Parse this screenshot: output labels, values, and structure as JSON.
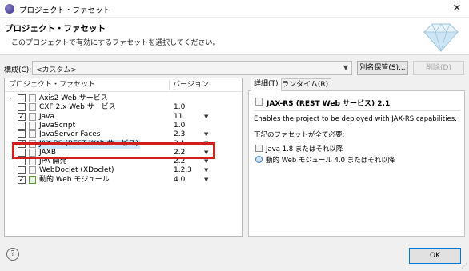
{
  "window": {
    "title": "プロジェクト・ファセット",
    "close_glyph": "✕"
  },
  "header": {
    "title": "プロジェクト・ファセット",
    "subtitle": "このプロジェクトで有効にするファセットを選択してください。"
  },
  "config": {
    "label": "構成(C):",
    "value": "<カスタム>",
    "save_as_label": "別名保管(S)...",
    "delete_label": "削除(D)"
  },
  "facet_table": {
    "col_name": "プロジェクト・ファセット",
    "col_version": "バージョン",
    "rows": [
      {
        "name": "Axis2 Web サービス",
        "version": "",
        "checked": false,
        "expandable": true,
        "dropdown": false,
        "icon": "folder"
      },
      {
        "name": "CXF 2.x Web サービス",
        "version": "1.0",
        "checked": false,
        "expandable": false,
        "dropdown": false,
        "icon": "file"
      },
      {
        "name": "Java",
        "version": "11",
        "checked": true,
        "expandable": false,
        "dropdown": true,
        "icon": "java"
      },
      {
        "name": "JavaScript",
        "version": "1.0",
        "checked": false,
        "expandable": false,
        "dropdown": false,
        "icon": "file"
      },
      {
        "name": "JavaServer Faces",
        "version": "2.3",
        "checked": false,
        "expandable": false,
        "dropdown": true,
        "icon": "file"
      },
      {
        "name": "JAX-RS (REST Web サービス)",
        "version": "2.1",
        "checked": true,
        "expandable": false,
        "dropdown": true,
        "icon": "file",
        "selected": true
      },
      {
        "name": "JAXB",
        "version": "2.2",
        "checked": false,
        "expandable": false,
        "dropdown": true,
        "icon": "file"
      },
      {
        "name": "JPA 開発",
        "version": "2.2",
        "checked": false,
        "expandable": false,
        "dropdown": true,
        "icon": "file"
      },
      {
        "name": "WebDoclet (XDoclet)",
        "version": "1.2.3",
        "checked": false,
        "expandable": false,
        "dropdown": true,
        "icon": "file"
      },
      {
        "name": "動的 Web モジュール",
        "version": "4.0",
        "checked": true,
        "expandable": false,
        "dropdown": true,
        "icon": "web"
      }
    ]
  },
  "details": {
    "tab_details": "詳細(T)",
    "tab_runtimes": "ランタイム(R)",
    "title": "JAX-RS (REST Web サービス) 2.1",
    "description": "Enables the project to be deployed with JAX-RS capabilities.",
    "requires_label": "下記のファセットが全て必要:",
    "requirements": [
      {
        "text": "Java 1.8 またはそれ以降",
        "icon": "java-icon"
      },
      {
        "text": "動的 Web モジュール 4.0 またはそれ以降",
        "icon": "globe-icon"
      }
    ]
  },
  "footer": {
    "help_glyph": "?",
    "ok_label": "OK"
  },
  "colors": {
    "highlight": "#d11f1f",
    "selection": "#cde8ff",
    "ok_border": "#0078d7"
  }
}
